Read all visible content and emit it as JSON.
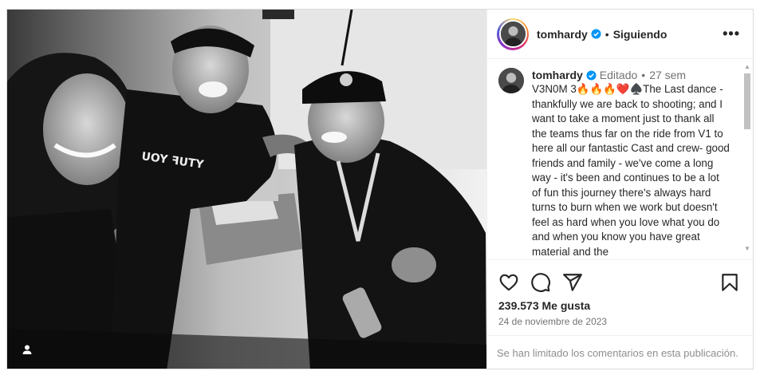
{
  "post": {
    "username": "tomhardy",
    "follow_status": "Siguiendo",
    "more_label": "•••",
    "dot": "•",
    "edited_label": "Editado",
    "time_ago": "27 sem",
    "caption": "V3N0M 3🔥🔥🔥❤️♠️The Last dance - thankfully we are back to shooting; and I want to take a moment just to thank all the teams thus far on the ride from V1 to here all our fantastic Cast and crew- good friends and family - we've come a long way - it's been and continues to be a lot of fun this journey there's always hard turns to burn when we work but doesn't feel as hard when you love what you do and when you know you have great material and the",
    "likes": "239.573 Me gusta",
    "date": "24 de noviembre de 2023",
    "comments_notice": "Se han limitado los comentarios en esta publicación.",
    "icons": [
      "heart-icon",
      "comment-icon",
      "share-icon",
      "bookmark-icon",
      "verified-badge-icon",
      "tagged-user-icon"
    ],
    "colors": {
      "verified": "#0095f6",
      "muted": "#737373",
      "text": "#262626",
      "border": "#dbdbdb"
    }
  }
}
